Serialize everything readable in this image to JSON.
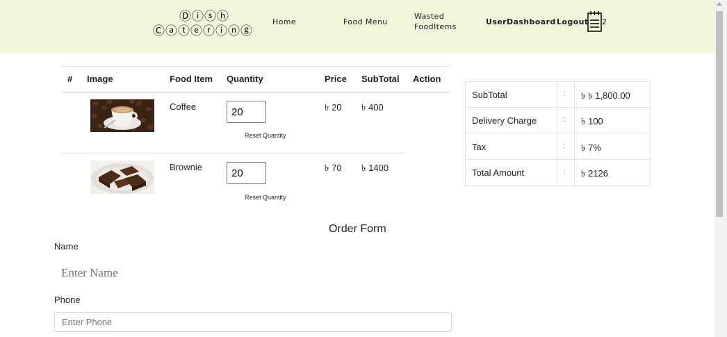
{
  "brand": {
    "line1": "Ⓓⓘⓢⓗ",
    "line2": "Ⓒⓐⓣⓔⓡⓘⓝⓖ"
  },
  "nav": {
    "home": "Home",
    "food_menu": "Food Menu",
    "wasted_line1": "Wasted",
    "wasted_line2": "FoodItems",
    "dashboard": "UserDashboard",
    "logout": "Logout",
    "cart_count": "2"
  },
  "cart": {
    "headers": [
      "#",
      "Image",
      "Food Item",
      "Quantity",
      "Price",
      "SubTotal",
      "Action"
    ],
    "reset_label": "Reset Quantity",
    "items": [
      {
        "image": "coffee-image",
        "name": "Coffee",
        "quantity": "20",
        "price": "৳ 20",
        "subtotal": "৳ 400"
      },
      {
        "image": "brownie-image",
        "name": "Brownie",
        "quantity": "20",
        "price": "৳ 70",
        "subtotal": "৳ 1400"
      }
    ]
  },
  "summary": {
    "rows": [
      {
        "label": "SubTotal",
        "sep": ":",
        "value": "৳ ৳ 1,800.00"
      },
      {
        "label": "Delivery Charge",
        "sep": ":",
        "value": "৳ 100"
      },
      {
        "label": "Tax",
        "sep": ":",
        "value": "৳ 7%"
      },
      {
        "label": "Total Amount",
        "sep": ":",
        "value": "৳ 2126"
      }
    ]
  },
  "order_form": {
    "title": "Order Form",
    "name_label": "Name",
    "name_placeholder": "Enter Name",
    "phone_label": "Phone",
    "phone_placeholder": "Enter Phone"
  }
}
